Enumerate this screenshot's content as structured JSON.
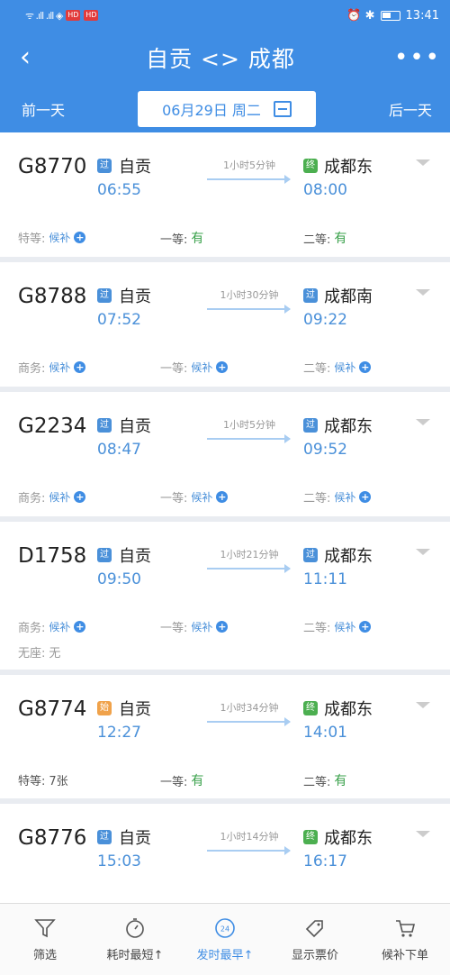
{
  "status_bar": {
    "signal_left": "ᯤ .ıll .ıll ◈",
    "badge1": "HD",
    "badge2": "HD",
    "right_icons": "⏰ ✱",
    "time": "13:41"
  },
  "header": {
    "title": "自贡 <> 成都",
    "prev_day": "前一天",
    "next_day": "后一天",
    "date": "06月29日 周二"
  },
  "trains": [
    {
      "number": "G8770",
      "from": {
        "name": "自贡",
        "time": "06:55",
        "badge": "过",
        "badge_color": "#4a90d9"
      },
      "to": {
        "name": "成都东",
        "time": "08:00",
        "badge": "终",
        "badge_color": "#4caf50"
      },
      "duration": "1小时5分钟",
      "seats": [
        {
          "label": "特等:",
          "value": "候补",
          "kind": "waitlist"
        },
        {
          "label": "一等:",
          "value": "有",
          "kind": "available"
        },
        {
          "label": "二等:",
          "value": "有",
          "kind": "available"
        }
      ]
    },
    {
      "number": "G8788",
      "from": {
        "name": "自贡",
        "time": "07:52",
        "badge": "过",
        "badge_color": "#4a90d9"
      },
      "to": {
        "name": "成都南",
        "time": "09:22",
        "badge": "过",
        "badge_color": "#4a90d9"
      },
      "duration": "1小时30分钟",
      "seats": [
        {
          "label": "商务:",
          "value": "候补",
          "kind": "waitlist"
        },
        {
          "label": "一等:",
          "value": "候补",
          "kind": "waitlist"
        },
        {
          "label": "二等:",
          "value": "候补",
          "kind": "waitlist"
        }
      ]
    },
    {
      "number": "G2234",
      "from": {
        "name": "自贡",
        "time": "08:47",
        "badge": "过",
        "badge_color": "#4a90d9"
      },
      "to": {
        "name": "成都东",
        "time": "09:52",
        "badge": "过",
        "badge_color": "#4a90d9"
      },
      "duration": "1小时5分钟",
      "seats": [
        {
          "label": "商务:",
          "value": "候补",
          "kind": "waitlist"
        },
        {
          "label": "一等:",
          "value": "候补",
          "kind": "waitlist"
        },
        {
          "label": "二等:",
          "value": "候补",
          "kind": "waitlist"
        }
      ]
    },
    {
      "number": "D1758",
      "from": {
        "name": "自贡",
        "time": "09:50",
        "badge": "过",
        "badge_color": "#4a90d9"
      },
      "to": {
        "name": "成都东",
        "time": "11:11",
        "badge": "过",
        "badge_color": "#4a90d9"
      },
      "duration": "1小时21分钟",
      "seats": [
        {
          "label": "商务:",
          "value": "候补",
          "kind": "waitlist"
        },
        {
          "label": "一等:",
          "value": "候补",
          "kind": "waitlist"
        },
        {
          "label": "二等:",
          "value": "候补",
          "kind": "waitlist"
        }
      ],
      "extra": {
        "label": "无座:",
        "value": "无"
      }
    },
    {
      "number": "G8774",
      "from": {
        "name": "自贡",
        "time": "12:27",
        "badge": "始",
        "badge_color": "#f0a24a"
      },
      "to": {
        "name": "成都东",
        "time": "14:01",
        "badge": "终",
        "badge_color": "#4caf50"
      },
      "duration": "1小时34分钟",
      "seats": [
        {
          "label": "特等:",
          "value": "7张",
          "kind": "count"
        },
        {
          "label": "一等:",
          "value": "有",
          "kind": "available"
        },
        {
          "label": "二等:",
          "value": "有",
          "kind": "available"
        }
      ]
    },
    {
      "number": "G8776",
      "from": {
        "name": "自贡",
        "time": "15:03",
        "badge": "过",
        "badge_color": "#4a90d9"
      },
      "to": {
        "name": "成都东",
        "time": "16:17",
        "badge": "终",
        "badge_color": "#4caf50"
      },
      "duration": "1小时14分钟",
      "seats": []
    }
  ],
  "bottom_nav": [
    {
      "label": "筛选",
      "icon": "filter-icon"
    },
    {
      "label": "耗时最短↑",
      "icon": "timer-icon"
    },
    {
      "label": "发时最早↑",
      "icon": "clock24-icon",
      "active": true
    },
    {
      "label": "显示票价",
      "icon": "price-tag-icon"
    },
    {
      "label": "候补下单",
      "icon": "cart-icon"
    }
  ],
  "colors": {
    "primary": "#3f8de4",
    "time_blue": "#4a90d9",
    "available_green": "#3aa14b"
  }
}
